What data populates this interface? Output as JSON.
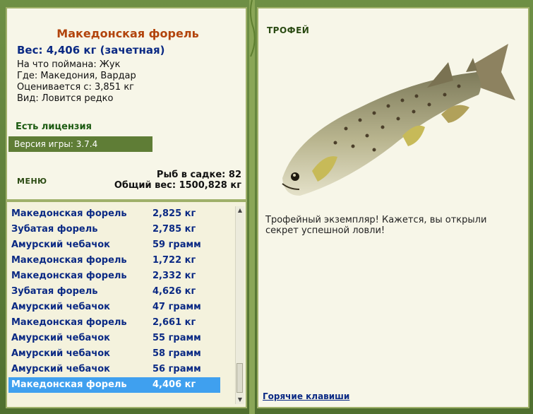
{
  "fish": {
    "name": "Македонская форель",
    "weight_line": "Вес: 4,406 кг (зачетная)",
    "bait": "На что поймана: Жук",
    "location": "Где: Македония, Вардар",
    "value": "Оценивается с: 3,851 кг",
    "rarity": "Вид: Ловится редко"
  },
  "license": "Есть лицензия",
  "version": "Версия игры: 3.7.4",
  "menu_label": "МЕНЮ",
  "keepnet": {
    "count_line": "Рыб в садке: 82",
    "total_line": "Общий вес: 1500,828 кг"
  },
  "catch_list": [
    {
      "name": "Македонская форель",
      "weight": "2,825 кг"
    },
    {
      "name": "Зубатая форель",
      "weight": "2,785 кг"
    },
    {
      "name": "Амурский чебачок",
      "weight": "59 грамм"
    },
    {
      "name": "Македонская форель",
      "weight": "1,722 кг"
    },
    {
      "name": "Македонская форель",
      "weight": "2,332 кг"
    },
    {
      "name": "Зубатая форель",
      "weight": "4,626 кг"
    },
    {
      "name": "Амурский чебачок",
      "weight": "47 грамм"
    },
    {
      "name": "Македонская форель",
      "weight": "2,661 кг"
    },
    {
      "name": "Амурский чебачок",
      "weight": "55 грамм"
    },
    {
      "name": "Амурский чебачок",
      "weight": "58 грамм"
    },
    {
      "name": "Амурский чебачок",
      "weight": "56 грамм"
    },
    {
      "name": "Македонская форель",
      "weight": "4,406 кг",
      "selected": true
    }
  ],
  "trophy_label": "ТРОФЕЙ",
  "trophy_text": "Трофейный экземпляр! Кажется, вы открыли секрет успешной ловли!",
  "hotkeys_label": "Горячие клавиши",
  "icons": {
    "scroll_up": "scroll-up-icon",
    "scroll_down": "scroll-down-icon",
    "fish": "trout-image"
  }
}
